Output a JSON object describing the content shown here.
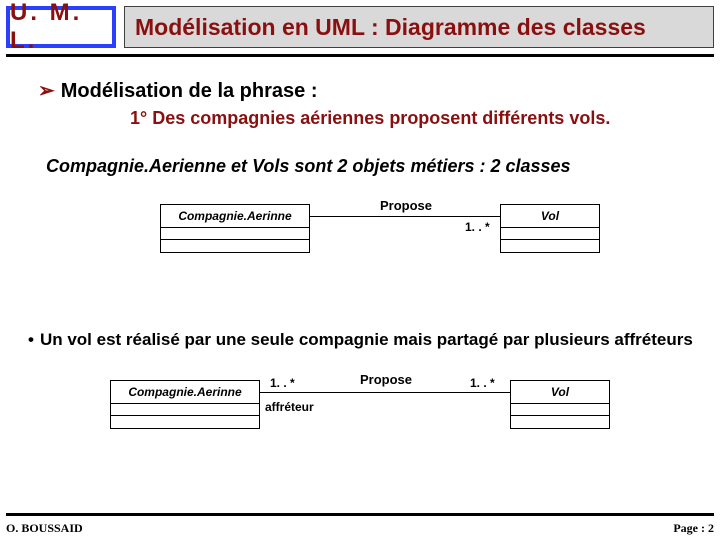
{
  "header": {
    "badge": "U. M. L.",
    "title": "Modélisation en UML : Diagramme des classes"
  },
  "arrow_glyph": "➢",
  "bullet1": "Modélisation de la phrase :",
  "sub1": "1° Des compagnies aériennes proposent différents vols.",
  "objline_a": "Compagnie.Aerienne",
  "objline_mid": " et ",
  "objline_b": "Vols",
  "objline_tail": " sont 2 objets métiers : 2 classes",
  "diagram1": {
    "classA": "Compagnie.Aerinne",
    "classB": "Vol",
    "assoc": "Propose",
    "multB": "1. . *"
  },
  "bullet2_dot": "•",
  "bullet2": "Un vol est réalisé par une seule compagnie mais partagé par plusieurs affréteurs",
  "diagram2": {
    "classA": "Compagnie.Aerinne",
    "classB": "Vol",
    "assoc": "Propose",
    "multA": "1. . *",
    "multB": "1. . *",
    "role": "affréteur"
  },
  "footer": {
    "left": "O. BOUSSAID",
    "right_label": "Page : ",
    "page": "2"
  }
}
